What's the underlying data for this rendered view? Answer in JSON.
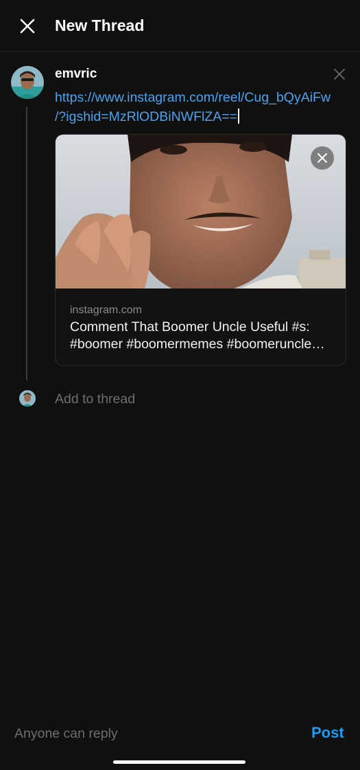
{
  "header": {
    "title": "New Thread",
    "close_icon": "close-icon"
  },
  "post": {
    "username": "emvric",
    "link_line1": "https://www.instagram.com/reel/Cug_bQyAiFw",
    "link_line2": "/?igshid=MzRlODBiNWFlZA==",
    "remove_icon": "close-icon"
  },
  "preview": {
    "domain": "instagram.com",
    "title_line1": "Comment That Boomer Uncle  Useful #s:",
    "title_line2": "#boomer #boomermemes #boomeruncle…",
    "image_icon": "video-thumbnail",
    "close_icon": "close-icon"
  },
  "add_thread": {
    "placeholder": "Add to thread"
  },
  "footer": {
    "reply_setting": "Anyone can reply",
    "post_label": "Post"
  },
  "colors": {
    "background": "#101010",
    "link": "#4aa3ef",
    "accent": "#1d9bf0",
    "muted": "#6e6e6e"
  }
}
